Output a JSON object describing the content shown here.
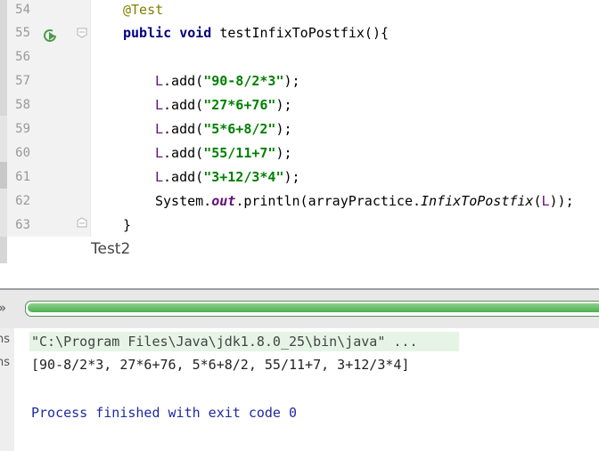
{
  "editor": {
    "lines": [
      {
        "no": "54",
        "text": "@Test"
      },
      {
        "no": "55",
        "text": "public void testInfixToPostfix(){"
      },
      {
        "no": "56",
        "text": ""
      },
      {
        "no": "57",
        "text": "L.add(\"90-8/2*3\");"
      },
      {
        "no": "58",
        "text": "L.add(\"27*6+76\");"
      },
      {
        "no": "59",
        "text": "L.add(\"5*6+8/2\");"
      },
      {
        "no": "60",
        "text": "L.add(\"55/11+7\");"
      },
      {
        "no": "61",
        "text": "L.add(\"3+12/3*4\");"
      },
      {
        "no": "62",
        "text": "System.out.println(arrayPractice.InfixToPostfix(L));"
      },
      {
        "no": "63",
        "text": "}"
      }
    ],
    "icons": {
      "run": "run-test-icon",
      "fold": "fold-marker-icon"
    }
  },
  "tab": {
    "label": "Test2"
  },
  "toolbar": {
    "chevron": "»",
    "progress": 1.0,
    "progress_color": "#4caf50"
  },
  "console": {
    "side_tabs": [
      "ns",
      "ns"
    ],
    "command": "\"C:\\Program Files\\Java\\jdk1.8.0_25\\bin\\java\" ...",
    "output": "[90-8/2*3, 27*6+76, 5*6+8/2, 55/11+7, 3+12/3*4]",
    "exit_message": "Process finished with exit code 0"
  }
}
